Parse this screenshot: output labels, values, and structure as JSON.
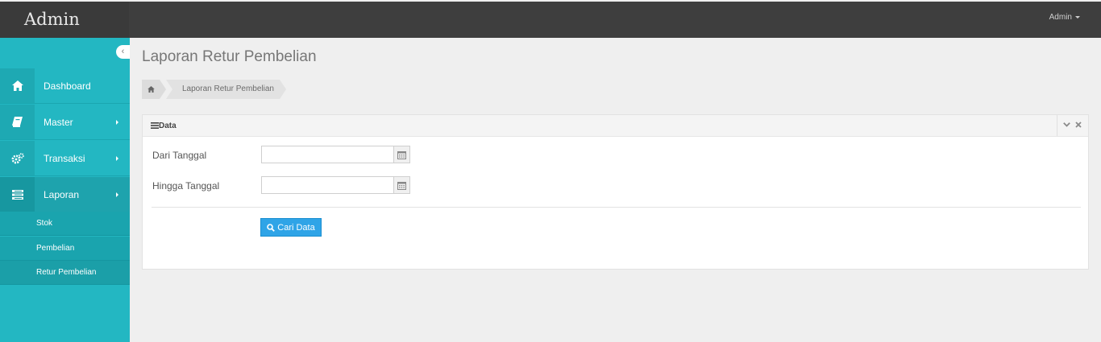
{
  "app": {
    "brand": "Admin"
  },
  "topbar": {
    "user": "Admin"
  },
  "sidebar": {
    "items": [
      {
        "label": "Dashboard",
        "icon": "home-icon"
      },
      {
        "label": "Master",
        "icon": "book-icon"
      },
      {
        "label": "Transaksi",
        "icon": "gears-icon"
      },
      {
        "label": "Laporan",
        "icon": "list-icon"
      }
    ],
    "submenu": [
      {
        "label": "Stok"
      },
      {
        "label": "Pembelian"
      },
      {
        "label": "Retur Pembelian"
      }
    ]
  },
  "page": {
    "title": "Laporan Retur Pembelian",
    "breadcrumb": [
      "Laporan Retur Pembelian"
    ]
  },
  "panel": {
    "title": "Data",
    "fields": [
      {
        "label": "Dari Tanggal",
        "value": ""
      },
      {
        "label": "Hingga Tanggal",
        "value": ""
      }
    ],
    "button": "Cari Data"
  },
  "colors": {
    "topbar": "#3e3e3e",
    "sidebar": "#23b7c2",
    "primary_button": "#2fa4e7",
    "background": "#efefef"
  }
}
